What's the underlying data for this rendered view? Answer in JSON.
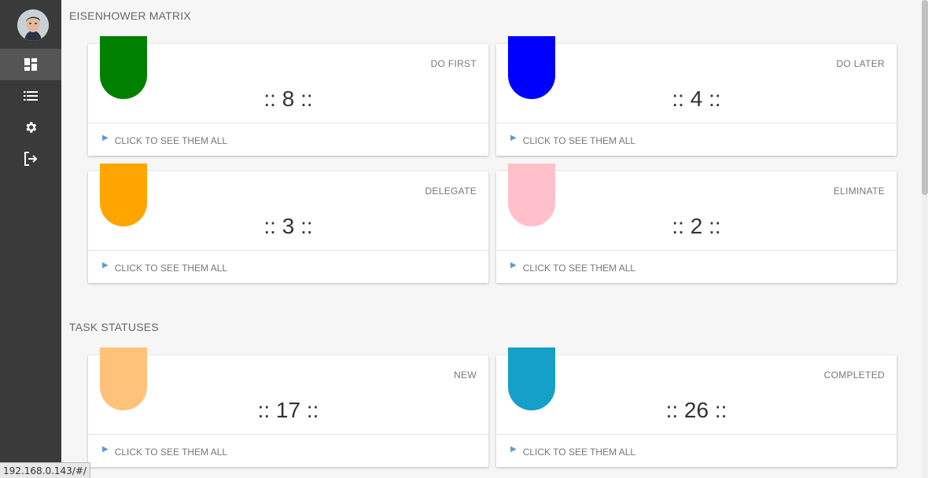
{
  "sidebar": {
    "items": [
      {
        "name": "dashboard-icon",
        "active": true
      },
      {
        "name": "list-icon",
        "active": false
      },
      {
        "name": "gear-icon",
        "active": false
      },
      {
        "name": "logout-icon",
        "active": false
      }
    ]
  },
  "sections": {
    "matrix_title": "EISENHOWER MATRIX",
    "statuses_title": "TASK STATUSES"
  },
  "cards": {
    "do_first": {
      "label": "DO FIRST",
      "count": ":: 8 ::",
      "footer": "CLICK TO SEE THEM ALL",
      "color": "#008000"
    },
    "do_later": {
      "label": "DO LATER",
      "count": ":: 4 ::",
      "footer": "CLICK TO SEE THEM ALL",
      "color": "#0000ff"
    },
    "delegate": {
      "label": "DELEGATE",
      "count": ":: 3 ::",
      "footer": "CLICK TO SEE THEM ALL",
      "color": "#ffa500"
    },
    "eliminate": {
      "label": "ELIMINATE",
      "count": ":: 2 ::",
      "footer": "CLICK TO SEE THEM ALL",
      "color": "#ffc0cb"
    },
    "new": {
      "label": "NEW",
      "count": ":: 17 ::",
      "footer": "CLICK TO SEE THEM ALL",
      "color": "#ffc27a"
    },
    "completed": {
      "label": "COMPLETED",
      "count": ":: 26 ::",
      "footer": "CLICK TO SEE THEM ALL",
      "color": "#14a0c8"
    }
  },
  "status_bar": {
    "url": "192.168.0.143/#/"
  }
}
